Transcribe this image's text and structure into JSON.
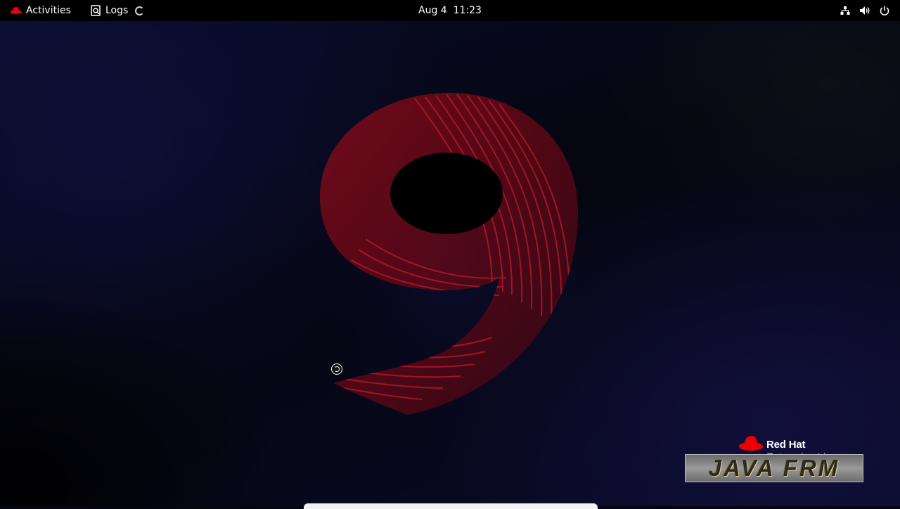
{
  "topbar": {
    "activities_label": "Activities",
    "app_label": "Logs",
    "clock": "Aug 4  11:23",
    "tray_icons": [
      "network-icon",
      "volume-icon",
      "power-icon"
    ]
  },
  "wallpaper": {
    "brand_name": "Red Hat",
    "brand_product": "Enterprise Linux",
    "watermark_text": "JAVA FRM",
    "colors": {
      "accent_red": "#ee0000",
      "background": "#05060f"
    }
  }
}
